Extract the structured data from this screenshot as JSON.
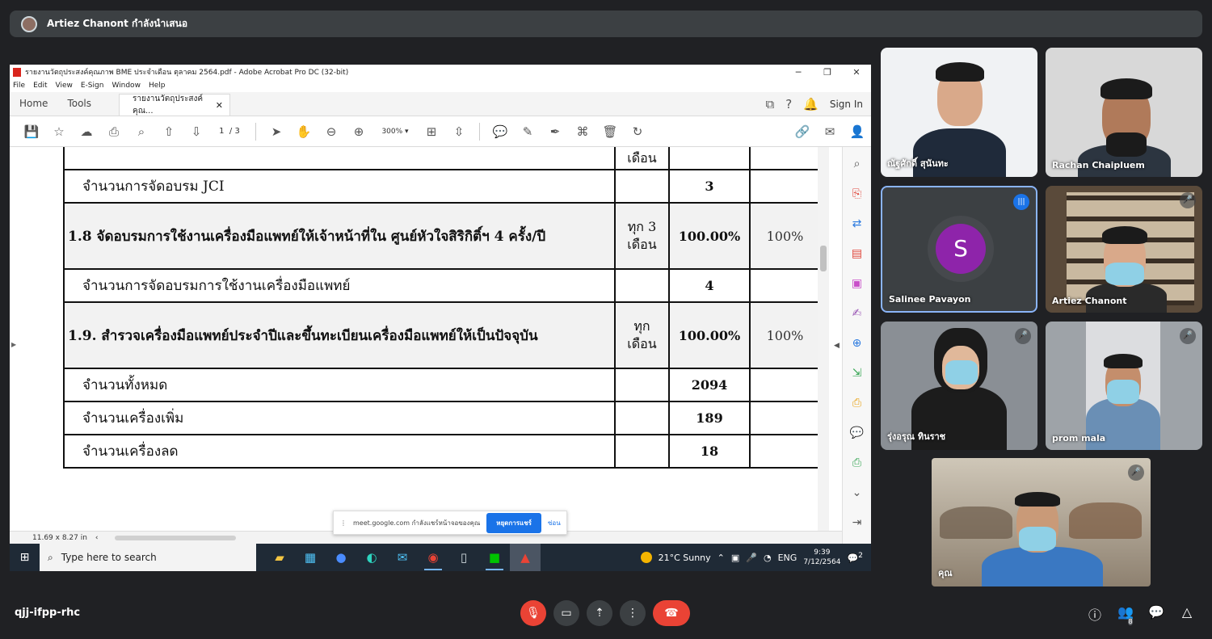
{
  "presenter": {
    "text": "Artiez Chanont กำลังนำเสนอ"
  },
  "acrobat": {
    "title": "รายงานวัตถุประสงค์คุณภาพ BME ประจำเดือน ตุลาคม 2564.pdf - Adobe Acrobat Pro DC (32-bit)",
    "menu": [
      "File",
      "Edit",
      "View",
      "E-Sign",
      "Window",
      "Help"
    ],
    "tabs": {
      "home": "Home",
      "tools": "Tools",
      "doc": "รายงานวัตถุประสงค์คุณ..."
    },
    "sign_in": "Sign In",
    "page_current": "1",
    "page_total": "/ 3",
    "zoom": "300%",
    "status_size": "11.69 x 8.27 in"
  },
  "table": {
    "top_cell": "เดือน",
    "rows": [
      {
        "label": "จำนวนการจัดอบรม JCI",
        "freq": "",
        "value": "3",
        "target": ""
      },
      {
        "label": "1.8 จัดอบรมการใช้งานเครื่องมือแพทย์ให้เจ้าหน้าที่ใน ศูนย์หัวใจสิริกิติ์ฯ 4 ครั้ง/ปี",
        "freq": "ทุก 3 เดือน",
        "value": "100.00%",
        "target": "100%"
      },
      {
        "label": "จำนวนการจัดอบรมการใช้งานเครื่องมือแพทย์",
        "freq": "",
        "value": "4",
        "target": ""
      },
      {
        "label": "1.9. สำรวจเครื่องมือแพทย์ประจำปีและขึ้นทะเบียนเครื่องมือแพทย์ให้เป็นปัจจุบัน",
        "freq": "ทุก เดือน",
        "value": "100.00%",
        "target": "100%"
      },
      {
        "label": "จำนวนทั้งหมด",
        "freq": "",
        "value": "2094",
        "target": ""
      },
      {
        "label": "จำนวนเครื่องเพิ่ม",
        "freq": "",
        "value": "189",
        "target": ""
      },
      {
        "label": "จำนวนเครื่องลด",
        "freq": "",
        "value": "18",
        "target": ""
      }
    ]
  },
  "share_bar": {
    "text": "meet.google.com กำลังแชร์หน้าจอของคุณ",
    "stop": "หยุดการแชร์",
    "hide": "ซ่อน"
  },
  "taskbar": {
    "search_placeholder": "Type here to search",
    "weather": "21°C  Sunny",
    "lang": "ENG",
    "time": "9:39",
    "date": "7/12/2564",
    "notif_count": "2"
  },
  "participants": [
    {
      "name": "ณัฐศักดิ์ สุนันทะ"
    },
    {
      "name": "Rachan Chaipluem"
    },
    {
      "name": "Salinee Pavayon",
      "initial": "S"
    },
    {
      "name": "Artiez Chanont"
    },
    {
      "name": "รุ่งอรุณ ทินราช"
    },
    {
      "name": "prom mala"
    },
    {
      "name": "คุณ"
    }
  ],
  "meeting": {
    "code": "qjj-ifpp-rhc",
    "people_count": "8"
  },
  "colors": {
    "end_call": "#ea4335",
    "speaking_border": "#8ab4f8",
    "avatar_bg": "#8e24aa"
  }
}
